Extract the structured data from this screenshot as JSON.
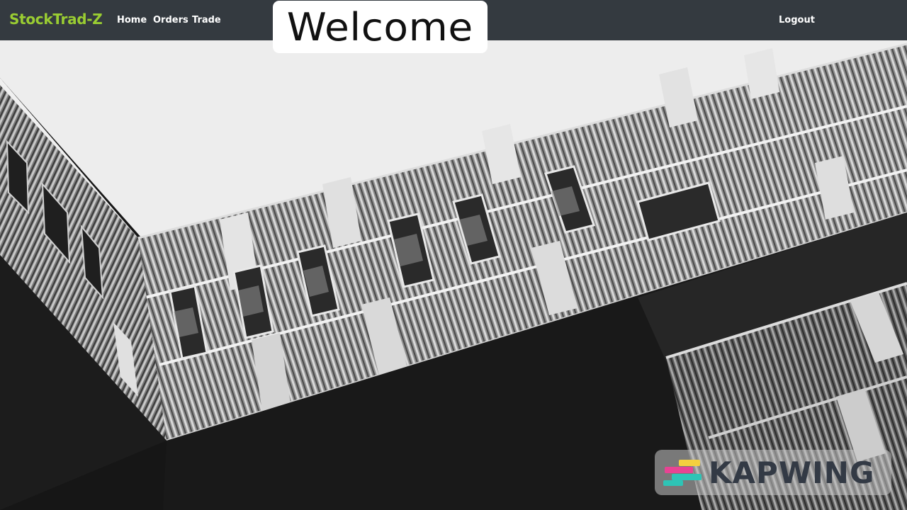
{
  "navbar": {
    "brand": "StockTrad-Z",
    "links": [
      "Home",
      "Orders",
      "Trade"
    ],
    "logout": "Logout",
    "background": "#343a40",
    "brand_color": "#9acd32"
  },
  "hero": {
    "heading": "Welcome",
    "image": "building-facade-image"
  },
  "watermark": {
    "text": "KAPWING",
    "logo": "kapwing-logo-icon"
  }
}
